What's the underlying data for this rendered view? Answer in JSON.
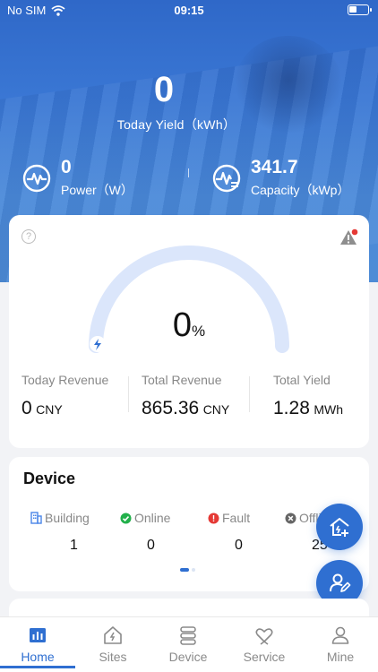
{
  "status_bar": {
    "carrier": "No SIM",
    "time": "09:15"
  },
  "hero": {
    "today_yield_value": "0",
    "today_yield_label": "Today Yield（kWh）",
    "power_value": "0",
    "power_label": "Power（W）",
    "capacity_value": "341.7",
    "capacity_label": "Capacity（kWp）"
  },
  "gauge": {
    "percent_value": "0",
    "percent_unit": "%",
    "fill_fraction": 0
  },
  "revenue": {
    "today_label": "Today Revenue",
    "today_value": "0",
    "today_unit": "CNY",
    "total_label": "Total Revenue",
    "total_value": "865.36",
    "total_unit": "CNY",
    "yield_label": "Total Yield",
    "yield_value": "1.28",
    "yield_unit": "MWh"
  },
  "device": {
    "title": "Device",
    "stats": [
      {
        "label": "Building",
        "value": "1"
      },
      {
        "label": "Online",
        "value": "0"
      },
      {
        "label": "Fault",
        "value": "0"
      },
      {
        "label": "Offline",
        "value": "25"
      }
    ]
  },
  "tabs": [
    {
      "label": "Home",
      "icon": "chart-bars-icon"
    },
    {
      "label": "Sites",
      "icon": "house-bolt-icon"
    },
    {
      "label": "Device",
      "icon": "stack-icon"
    },
    {
      "label": "Service",
      "icon": "heart-hands-icon"
    },
    {
      "label": "Mine",
      "icon": "person-icon"
    }
  ],
  "colors": {
    "accent": "#2f6fd1",
    "online": "#22b04b",
    "fault": "#e53935",
    "offline": "#666666"
  }
}
